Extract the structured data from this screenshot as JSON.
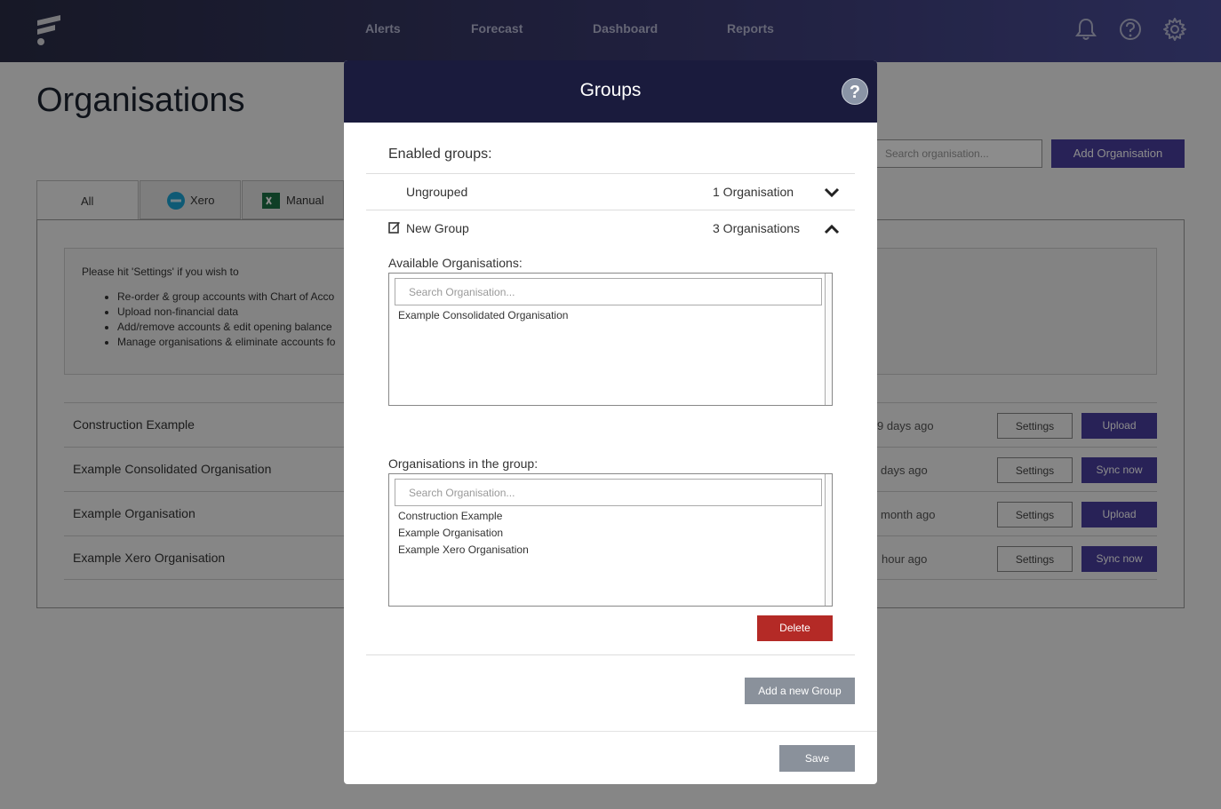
{
  "nav": {
    "items": [
      "Alerts",
      "Forecast",
      "Dashboard",
      "Reports"
    ]
  },
  "page": {
    "title": "Organisations",
    "search_placeholder": "Search organisation...",
    "add_button": "Add Organisation"
  },
  "tabs": [
    {
      "label": "All"
    },
    {
      "label": "Xero"
    },
    {
      "label": "Manual"
    }
  ],
  "info": {
    "intro": "Please hit 'Settings' if you wish to",
    "bullets": [
      "Re-order & group accounts with Chart of Acco",
      "Upload non-financial data",
      "Add/remove accounts & edit opening balance",
      "Manage organisations & eliminate accounts fo"
    ]
  },
  "orgs": [
    {
      "name": "Construction Example",
      "time": "9 days ago",
      "settings": "Settings",
      "action": "Upload"
    },
    {
      "name": "Example Consolidated Organisation",
      "time": "days ago",
      "settings": "Settings",
      "action": "Sync now"
    },
    {
      "name": "Example Organisation",
      "time": "month ago",
      "settings": "Settings",
      "action": "Upload"
    },
    {
      "name": "Example Xero Organisation",
      "time": "hour ago",
      "settings": "Settings",
      "action": "Sync now"
    }
  ],
  "modal": {
    "title": "Groups",
    "help": "?",
    "enabled_label": "Enabled groups:",
    "groups": [
      {
        "name": "Ungrouped",
        "count": "1 Organisation"
      },
      {
        "name": "New Group",
        "count": "3 Organisations"
      }
    ],
    "available_label": "Available Organisations:",
    "available_placeholder": "Search Organisation...",
    "available_items": [
      "Example Consolidated Organisation"
    ],
    "in_group_label": "Organisations in the group:",
    "in_group_placeholder": "Search Organisation...",
    "in_group_items": [
      "Construction Example",
      "Example Organisation",
      "Example Xero Organisation"
    ],
    "delete": "Delete",
    "add_group": "Add a new Group",
    "save": "Save"
  },
  "colors": {
    "accent": "#4a3e9e",
    "danger": "#b42a26",
    "modal_header": "#1a1b3d"
  }
}
